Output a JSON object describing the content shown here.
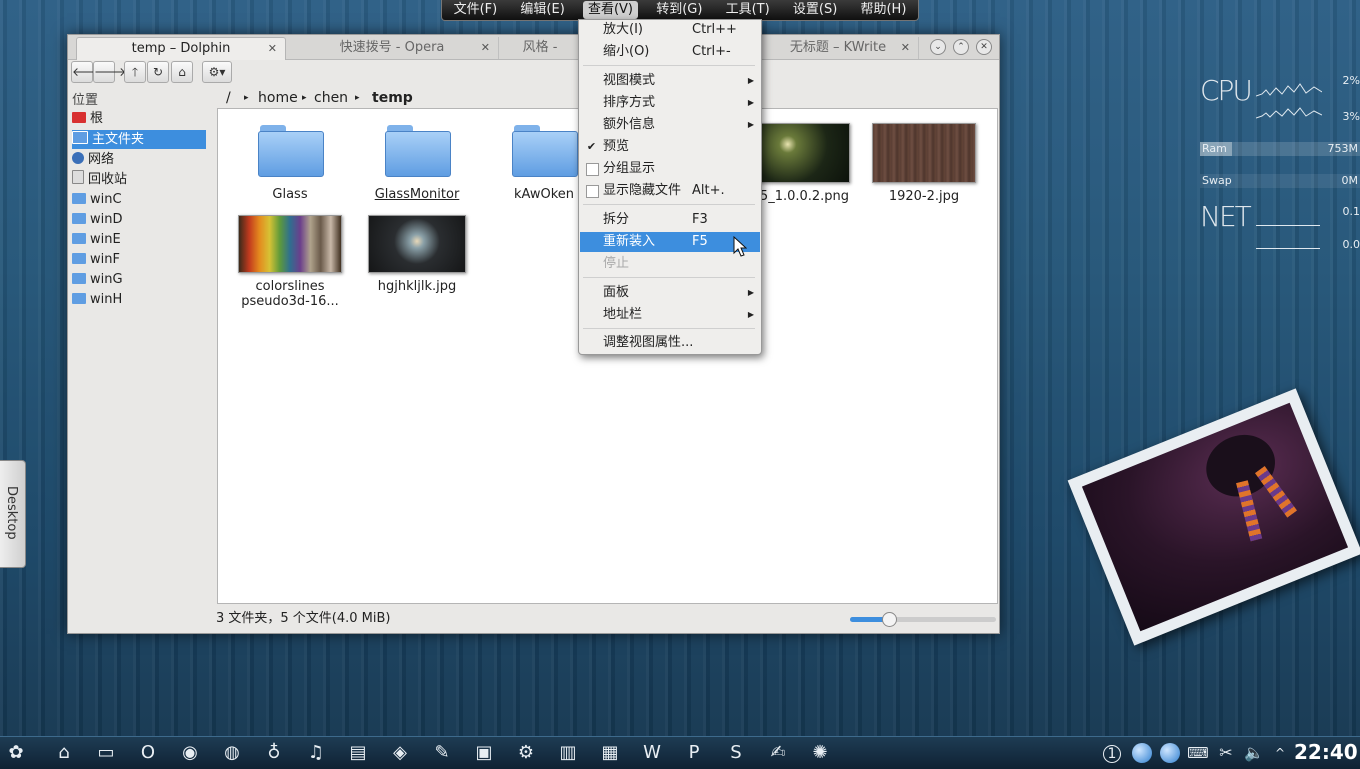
{
  "menubar": {
    "items": [
      "文件(F)",
      "编辑(E)",
      "查看(V)",
      "转到(G)",
      "工具(T)",
      "设置(S)",
      "帮助(H)"
    ],
    "active_index": 2
  },
  "tabs": [
    {
      "label": "temp – Dolphin",
      "active": true
    },
    {
      "label": "快速拨号 - Opera",
      "active": false
    },
    {
      "label": "风格 -",
      "active": false
    },
    {
      "label": "无标题 – KWrite",
      "active": false
    }
  ],
  "toolbar": {
    "back": "back-icon",
    "forward": "forward-icon",
    "up": "up-icon",
    "reload": "reload-icon",
    "home": "home-icon",
    "settings": "gear-icon"
  },
  "sidebar": {
    "heading": "位置",
    "items": [
      {
        "label": "根",
        "icon": "red-folder-icon",
        "color": "#d83030"
      },
      {
        "label": "主文件夹",
        "icon": "home-folder-icon",
        "color": "#5f9de2",
        "selected": true
      },
      {
        "label": "网络",
        "icon": "globe-icon",
        "color": "#3a6fb8"
      },
      {
        "label": "回收站",
        "icon": "trash-icon",
        "color": "#ddd"
      },
      {
        "label": "winC",
        "icon": "folder-icon",
        "color": "#5f9de2"
      },
      {
        "label": "winD",
        "icon": "folder-icon",
        "color": "#5f9de2"
      },
      {
        "label": "winE",
        "icon": "folder-icon",
        "color": "#5f9de2"
      },
      {
        "label": "winF",
        "icon": "folder-icon",
        "color": "#5f9de2"
      },
      {
        "label": "winG",
        "icon": "folder-icon",
        "color": "#5f9de2"
      },
      {
        "label": "winH",
        "icon": "folder-icon",
        "color": "#5f9de2"
      }
    ]
  },
  "breadcrumb": {
    "root": "/",
    "parts": [
      "home",
      "chen"
    ],
    "current": "temp"
  },
  "files": [
    {
      "label": "Glass",
      "kind": "folder"
    },
    {
      "label": "GlassMonitor",
      "kind": "folder"
    },
    {
      "label": "kAwOken",
      "kind": "folder"
    },
    {
      "label": "…5_1.0.0.2.png",
      "kind": "image"
    },
    {
      "label": "1920-2.jpg",
      "kind": "image"
    },
    {
      "label": "colorslines pseudo3d-16...",
      "kind": "image"
    },
    {
      "label": "hgjhkljlk.jpg",
      "kind": "image"
    }
  ],
  "statusbar": {
    "text": "3 文件夹，5 个文件(4.0 MiB)",
    "zoom_fraction": 0.27
  },
  "view_menu": {
    "items": [
      {
        "label": "放大(I)",
        "shortcut": "Ctrl++"
      },
      {
        "label": "缩小(O)",
        "shortcut": "Ctrl+-"
      },
      {
        "label": "视图模式",
        "submenu": true
      },
      {
        "label": "排序方式",
        "submenu": true
      },
      {
        "label": "额外信息",
        "submenu": true
      },
      {
        "label": "预览",
        "checked": true
      },
      {
        "label": "分组显示",
        "checked": false
      },
      {
        "label": "显示隐藏文件",
        "shortcut": "Alt+.",
        "checked": false
      },
      {
        "label": "拆分",
        "shortcut": "F3"
      },
      {
        "label": "重新装入",
        "shortcut": "F5",
        "highlighted": true
      },
      {
        "label": "停止",
        "disabled": true
      },
      {
        "label": "面板",
        "submenu": true
      },
      {
        "label": "地址栏",
        "submenu": true
      },
      {
        "label": "调整视图属性..."
      }
    ]
  },
  "desktop_tab": "Desktop",
  "sysmon": {
    "cpu_label": "CPU",
    "cpu1": "2%",
    "cpu2": "3%",
    "ram_label": "Ram",
    "ram_value": "753M",
    "ram_fraction": 0.2,
    "swap_label": "Swap",
    "swap_value": "0M",
    "net_label": "NET",
    "net1": "0.1",
    "net2": "0.0"
  },
  "tray": {
    "clock": "22:40",
    "badge": "1"
  }
}
